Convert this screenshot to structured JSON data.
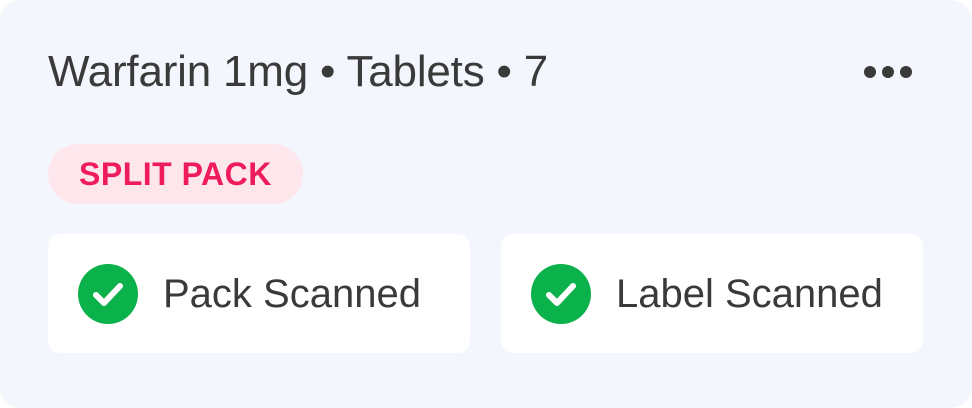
{
  "card": {
    "title": "Warfarin 1mg • Tablets • 7",
    "badge": "SPLIT PACK",
    "checks": [
      {
        "label": "Pack Scanned",
        "status": "complete",
        "icon": "check-circle-icon"
      },
      {
        "label": "Label Scanned",
        "status": "complete",
        "icon": "check-circle-icon"
      }
    ],
    "menu_icon": "more-horizontal-icon"
  },
  "colors": {
    "background": "#f3f6fc",
    "text": "#3a3a3a",
    "badge_bg": "#fde6ec",
    "badge_text": "#ee1c5a",
    "success": "#0bb14a",
    "tile_bg": "#ffffff"
  }
}
